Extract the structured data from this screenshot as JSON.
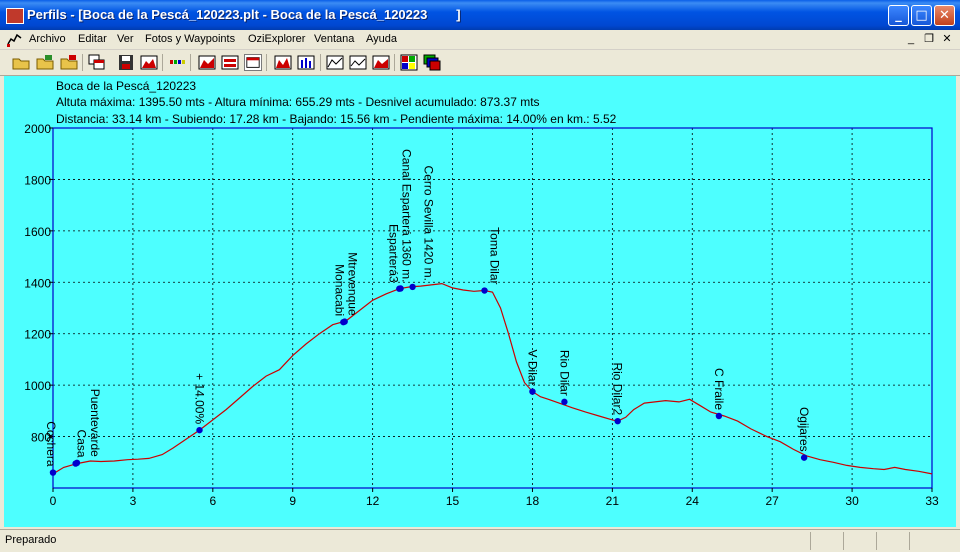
{
  "window": {
    "title": "Perfils - [Boca de la Pescá_120223.plt - Boca de la Pescá_120223        ]",
    "controls": {
      "minimize": "_",
      "maximize": "□",
      "close": "✕"
    }
  },
  "menu": {
    "items": [
      "Archivo",
      "Editar",
      "Ver",
      "Fotos y Waypoints",
      "OziExplorer",
      "Ventana",
      "Ayuda"
    ],
    "mdi_controls": [
      "_",
      "❐",
      "✕"
    ]
  },
  "toolbar": {
    "icons": [
      "open-folder-icon",
      "open-folder-2-icon",
      "open-folder-3-icon",
      "copy-windows-icon",
      "save-icon",
      "profile-red-icon",
      "color-bars-icon",
      "profile-area-icon",
      "profile-area-2-icon",
      "profile-window-icon",
      "profile-area-3-icon",
      "profile-bars-icon",
      "profile-line-icon",
      "profile-line-2-icon",
      "profile-red-2-icon",
      "color-palette-icon",
      "layers-icon"
    ]
  },
  "header": {
    "track_name": "Boca de la Pescá_120223",
    "line1": "Altuta máxima: 1395.50 mts - Altura mínima: 655.29 mts - Desnivel acumulado: 873.37 mts",
    "line2": "Distancia: 33.14 km - Subiendo: 17.28 km - Bajando: 15.56 km - Pendiente máxima: 14.00% en km.: 5.52"
  },
  "chart_data": {
    "type": "line",
    "xlim": [
      0,
      33
    ],
    "ylim": [
      600,
      2000
    ],
    "x_ticks": [
      0,
      3,
      6,
      9,
      12,
      15,
      18,
      21,
      24,
      27,
      30,
      33
    ],
    "y_ticks": [
      800,
      1000,
      1200,
      1400,
      1600,
      1800,
      2000
    ],
    "grid": true,
    "line_color": "#cc0000",
    "marker_color": "#0000cc",
    "profile": {
      "x": [
        0,
        0.4,
        0.9,
        1.4,
        1.8,
        2.3,
        2.8,
        3.2,
        3.6,
        4.1,
        4.5,
        5.0,
        5.5,
        6.0,
        6.5,
        7.0,
        7.5,
        8.0,
        8.5,
        9.0,
        9.5,
        10.0,
        10.5,
        11.0,
        11.5,
        12.0,
        12.5,
        13.0,
        13.4,
        13.8,
        14.2,
        14.6,
        15.0,
        15.4,
        15.8,
        16.2,
        16.5,
        16.8,
        17.1,
        17.4,
        17.7,
        18.0,
        18.3,
        18.6,
        19.0,
        19.5,
        20.0,
        20.5,
        21.0,
        21.2,
        21.5,
        21.8,
        22.2,
        22.6,
        23.0,
        23.5,
        23.9,
        24.3,
        24.7,
        25.2,
        25.7,
        26.2,
        26.8,
        27.3,
        27.8,
        28.3,
        28.8,
        29.3,
        29.8,
        30.3,
        30.8,
        31.2,
        31.6,
        32.0,
        32.5,
        33.0
      ],
      "y": [
        655,
        680,
        695,
        705,
        703,
        705,
        710,
        712,
        715,
        730,
        755,
        790,
        825,
        865,
        905,
        950,
        995,
        1035,
        1060,
        1115,
        1160,
        1200,
        1235,
        1250,
        1290,
        1330,
        1355,
        1375,
        1382,
        1385,
        1390,
        1395,
        1378,
        1370,
        1365,
        1368,
        1362,
        1300,
        1200,
        1090,
        1010,
        975,
        955,
        945,
        930,
        912,
        895,
        880,
        865,
        860,
        875,
        905,
        930,
        935,
        940,
        935,
        945,
        920,
        895,
        880,
        860,
        830,
        800,
        780,
        750,
        725,
        710,
        700,
        688,
        680,
        675,
        672,
        680,
        672,
        665,
        655
      ]
    },
    "waypoints": [
      {
        "name": "Cochera",
        "x": 0.0,
        "y": 660
      },
      {
        "name": "Casa",
        "x": 0.85,
        "y": 695
      },
      {
        "name": "Puentevarde",
        "x": 0.9,
        "y": 698
      },
      {
        "name": "+ 14.00%",
        "x": 5.5,
        "y": 825
      },
      {
        "name": "Monacabi",
        "x": 10.9,
        "y": 1245
      },
      {
        "name": "Mtrevenque",
        "x": 10.95,
        "y": 1247
      },
      {
        "name": "Esparterá3",
        "x": 13.0,
        "y": 1375
      },
      {
        "name": "Canal Esparterá 1360 m.",
        "x": 13.05,
        "y": 1376
      },
      {
        "name": "Cerro Sevilla 1420 m.",
        "x": 13.5,
        "y": 1382
      },
      {
        "name": "Toma Dilar",
        "x": 16.2,
        "y": 1368
      },
      {
        "name": "V Dilar",
        "x": 18.0,
        "y": 975
      },
      {
        "name": "Rio Dilar",
        "x": 19.2,
        "y": 935
      },
      {
        "name": "Rio Dilar2",
        "x": 21.2,
        "y": 860
      },
      {
        "name": "C Fraile",
        "x": 25.0,
        "y": 880
      },
      {
        "name": "Ogijares",
        "x": 28.2,
        "y": 718
      }
    ]
  },
  "status": {
    "text": "Preparado"
  }
}
